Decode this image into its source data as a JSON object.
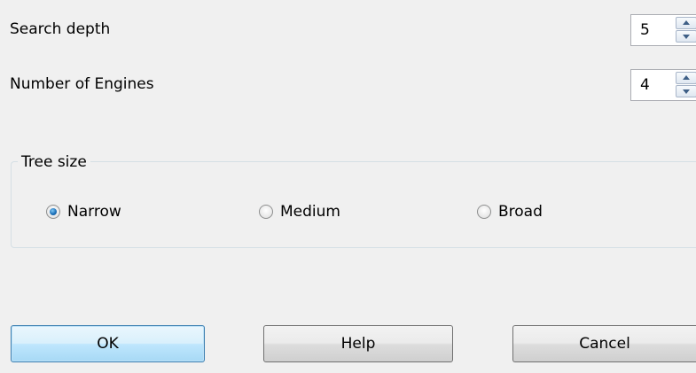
{
  "fields": {
    "search_depth": {
      "label": "Search depth",
      "value": "5"
    },
    "num_engines": {
      "label": "Number of Engines",
      "value": "4"
    }
  },
  "tree_size": {
    "title": "Tree size",
    "options": [
      {
        "label": "Narrow",
        "checked": true
      },
      {
        "label": "Medium",
        "checked": false
      },
      {
        "label": "Broad",
        "checked": false
      }
    ]
  },
  "buttons": {
    "ok": "OK",
    "help": "Help",
    "cancel": "Cancel"
  },
  "icons": {
    "spin_up": "spin-up-icon",
    "spin_down": "spin-down-icon"
  }
}
